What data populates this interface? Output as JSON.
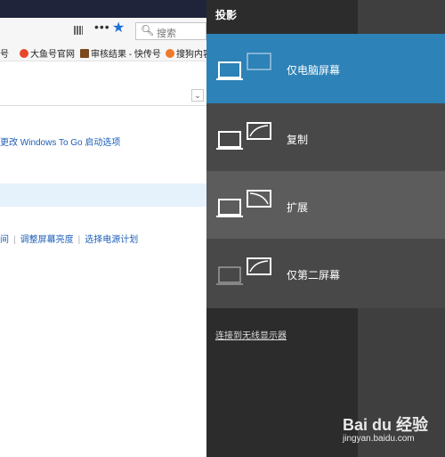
{
  "browser": {
    "search_placeholder": "搜索",
    "menu_dots": "•••",
    "bookmarks": [
      {
        "label": "家号",
        "icon_color": "#ffffff"
      },
      {
        "label": "大鱼号官网",
        "icon_color": "#e8472b"
      },
      {
        "label": "审核结果 - 快传号",
        "icon_color": "#7a4a1c"
      },
      {
        "label": "搜狗内容",
        "icon_color": "#f07a28"
      }
    ]
  },
  "content": {
    "windows_to_go_link": "更改 Windows To Go 启动选项",
    "links": [
      "间",
      "调整屏幕亮度",
      "选择电源计划"
    ]
  },
  "panel": {
    "title": "投影",
    "options": [
      {
        "label": "仅电脑屏幕",
        "selected": true
      },
      {
        "label": "复制",
        "selected": false
      },
      {
        "label": "扩展",
        "selected": false
      },
      {
        "label": "仅第二屏幕",
        "selected": false
      }
    ],
    "wireless_link": "连接到无线显示器"
  },
  "watermark": {
    "logo": "Bai du 经验",
    "url": "jingyan.baidu.com"
  }
}
